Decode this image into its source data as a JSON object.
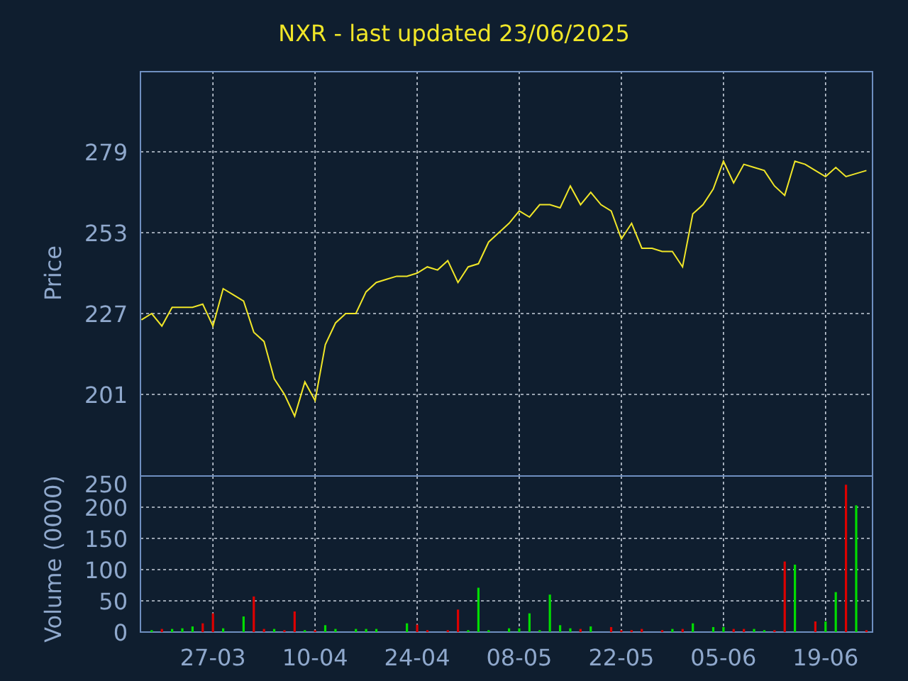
{
  "title": "NXR - last updated 23/06/2025",
  "price_chart": {
    "chart_data": {
      "type": "line",
      "grid": true,
      "ylabel": "Price",
      "ylim": [
        175,
        305
      ],
      "yticks": [
        201,
        227,
        253,
        279
      ],
      "series": [
        {
          "color": "#f0e628",
          "values": [
            225,
            227,
            223,
            229,
            229,
            229,
            230,
            223,
            235,
            233,
            231,
            221,
            218,
            206,
            201,
            194,
            205,
            199,
            217,
            224,
            227,
            227,
            234,
            237,
            238,
            239,
            239,
            240,
            242,
            241,
            244,
            237,
            242,
            243,
            250,
            253,
            256,
            260,
            258,
            262,
            262,
            261,
            268,
            262,
            266,
            262,
            260,
            251,
            256,
            248,
            248,
            247,
            247,
            242,
            259,
            262,
            267,
            276,
            269,
            275,
            274,
            273,
            268,
            265,
            276,
            275,
            273,
            271,
            274,
            271,
            272,
            273
          ]
        }
      ]
    }
  },
  "volume_chart": {
    "chart_data": {
      "type": "bar",
      "grid": true,
      "ylabel": "Volume (0000)",
      "ylim": [
        0,
        250
      ],
      "yticks": [
        0,
        50,
        100,
        150,
        200,
        250
      ],
      "categories": [
        null,
        null,
        null,
        null,
        null,
        null,
        null,
        "27-03",
        null,
        null,
        null,
        null,
        null,
        null,
        null,
        null,
        null,
        "10-04",
        null,
        null,
        null,
        null,
        null,
        null,
        null,
        null,
        null,
        "24-04",
        null,
        null,
        null,
        null,
        null,
        null,
        null,
        null,
        null,
        "08-05",
        null,
        null,
        null,
        null,
        null,
        null,
        null,
        null,
        null,
        "22-05",
        null,
        null,
        null,
        null,
        null,
        null,
        null,
        null,
        null,
        "05-06",
        null,
        null,
        null,
        null,
        null,
        null,
        null,
        null,
        null,
        "19-06",
        null,
        null,
        null,
        null
      ],
      "series": [
        {
          "color": "#00dd00",
          "values": [
            null,
            3,
            null,
            5,
            6,
            9,
            null,
            null,
            6,
            null,
            25,
            null,
            null,
            5,
            null,
            null,
            3,
            null,
            11,
            5,
            null,
            5,
            5,
            5,
            null,
            null,
            14,
            null,
            null,
            null,
            null,
            null,
            3,
            71,
            3,
            null,
            6,
            6,
            30,
            3,
            60,
            11,
            6,
            null,
            9,
            null,
            null,
            null,
            null,
            null,
            null,
            null,
            5,
            null,
            14,
            null,
            8,
            8,
            null,
            null,
            5,
            3,
            null,
            null,
            108,
            null,
            null,
            17,
            64,
            null,
            203,
            null
          ]
        },
        {
          "color": "#dd0000",
          "values": [
            null,
            null,
            5,
            null,
            null,
            null,
            14,
            30,
            null,
            null,
            null,
            57,
            5,
            null,
            3,
            33,
            null,
            3,
            null,
            null,
            null,
            null,
            null,
            null,
            null,
            null,
            null,
            12,
            3,
            null,
            3,
            36,
            null,
            null,
            null,
            null,
            null,
            null,
            null,
            null,
            null,
            null,
            null,
            5,
            null,
            null,
            8,
            3,
            3,
            5,
            null,
            3,
            null,
            5,
            null,
            null,
            null,
            null,
            5,
            5,
            null,
            null,
            3,
            113,
            null,
            null,
            17,
            null,
            null,
            236,
            null,
            3
          ]
        }
      ]
    }
  }
}
